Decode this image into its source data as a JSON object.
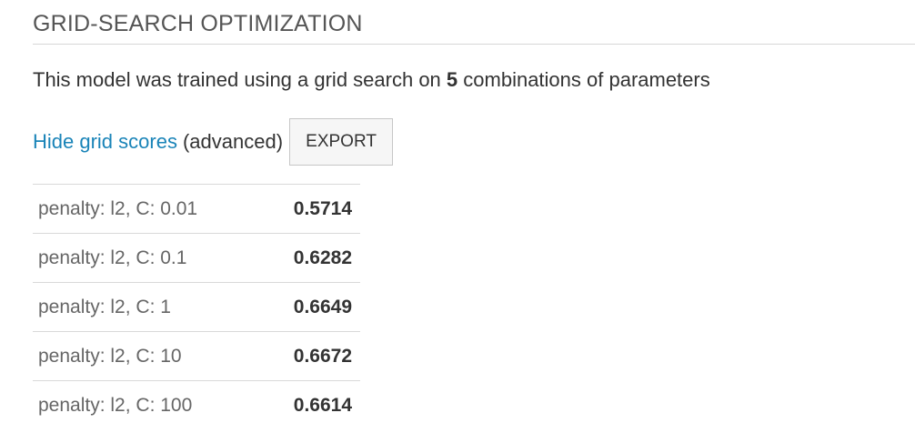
{
  "section": {
    "title": "GRID-SEARCH OPTIMIZATION"
  },
  "description": {
    "prefix": "This model was trained using a grid search on ",
    "count": "5",
    "suffix": " combinations of parameters"
  },
  "actions": {
    "toggle_link": "Hide grid scores",
    "advanced_note": "(advanced)",
    "export_label": "EXPORT"
  },
  "colors": {
    "link": "#1a84b8",
    "title": "#555555",
    "text": "#333333"
  },
  "grid_scores": {
    "rows": [
      {
        "params": "penalty: l2, C: 0.01",
        "score": "0.5714"
      },
      {
        "params": "penalty: l2, C: 0.1",
        "score": "0.6282"
      },
      {
        "params": "penalty: l2, C: 1",
        "score": "0.6649"
      },
      {
        "params": "penalty: l2, C: 10",
        "score": "0.6672"
      },
      {
        "params": "penalty: l2, C: 100",
        "score": "0.6614"
      }
    ]
  }
}
